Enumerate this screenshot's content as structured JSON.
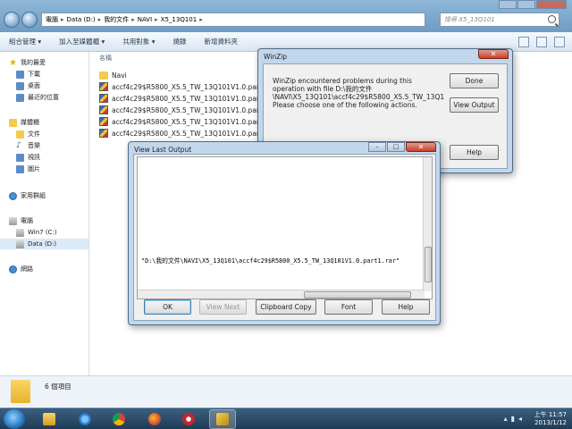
{
  "explorer": {
    "address": [
      "電腦",
      "Data (D:)",
      "我的文件",
      "NAVI",
      "X5_13Q101"
    ],
    "search_placeholder": "搜尋 X5_13Q101",
    "toolbar": [
      "組合管理 ▾",
      "加入至媒體櫃 ▾",
      "共用對象 ▾",
      "燒錄",
      "新增資料夾"
    ],
    "nav": {
      "favorites": "我的最愛",
      "downloads": "下載",
      "desktop": "桌面",
      "recent": "最近的位置",
      "libraries": "媒體櫃",
      "documents": "文件",
      "music": "音樂",
      "videos": "視訊",
      "pictures": "圖片",
      "homegroup": "家用群組",
      "computer": "電腦",
      "drive_c": "Win7 (C:)",
      "drive_d": "Data (D:)",
      "network": "網路"
    },
    "column_name": "名稱",
    "files": [
      "Navi",
      "accf4c29$R5800_X5.5_TW_13Q101V1.0.part1",
      "accf4c29$R5800_X5.5_TW_13Q101V1.0.part2",
      "accf4c29$R5800_X5.5_TW_13Q101V1.0.part3",
      "accf4c29$R5800_X5.5_TW_13Q101V1.0.part4",
      "accf4c29$R5800_X5.5_TW_13Q101V1.0.part5"
    ],
    "status": "6 個項目"
  },
  "winzip": {
    "title": "WinZip",
    "message": "WinZip encountered problems during this\noperation with file D:\\我的文件\n\\NAVI\\X5_13Q101\\accf4c29$R5800_X5.5_TW_13Q1\n Please choose one of the following actions.",
    "done": "Done",
    "view_output": "View Output",
    "help": "Help"
  },
  "output_dialog": {
    "title": "View Last Output",
    "line": "\"D:\\我的文件\\NAVI\\X5_13Q101\\accf4c29$R5800_X5.5_TW_13Q101V1.0.part1.rar\"",
    "ok": "OK",
    "view_next": "View Next",
    "clipboard": "Clipboard Copy",
    "font": "Font",
    "help": "Help"
  },
  "taskbar": {
    "time": "上午 11:57",
    "date": "2013/1/12"
  }
}
